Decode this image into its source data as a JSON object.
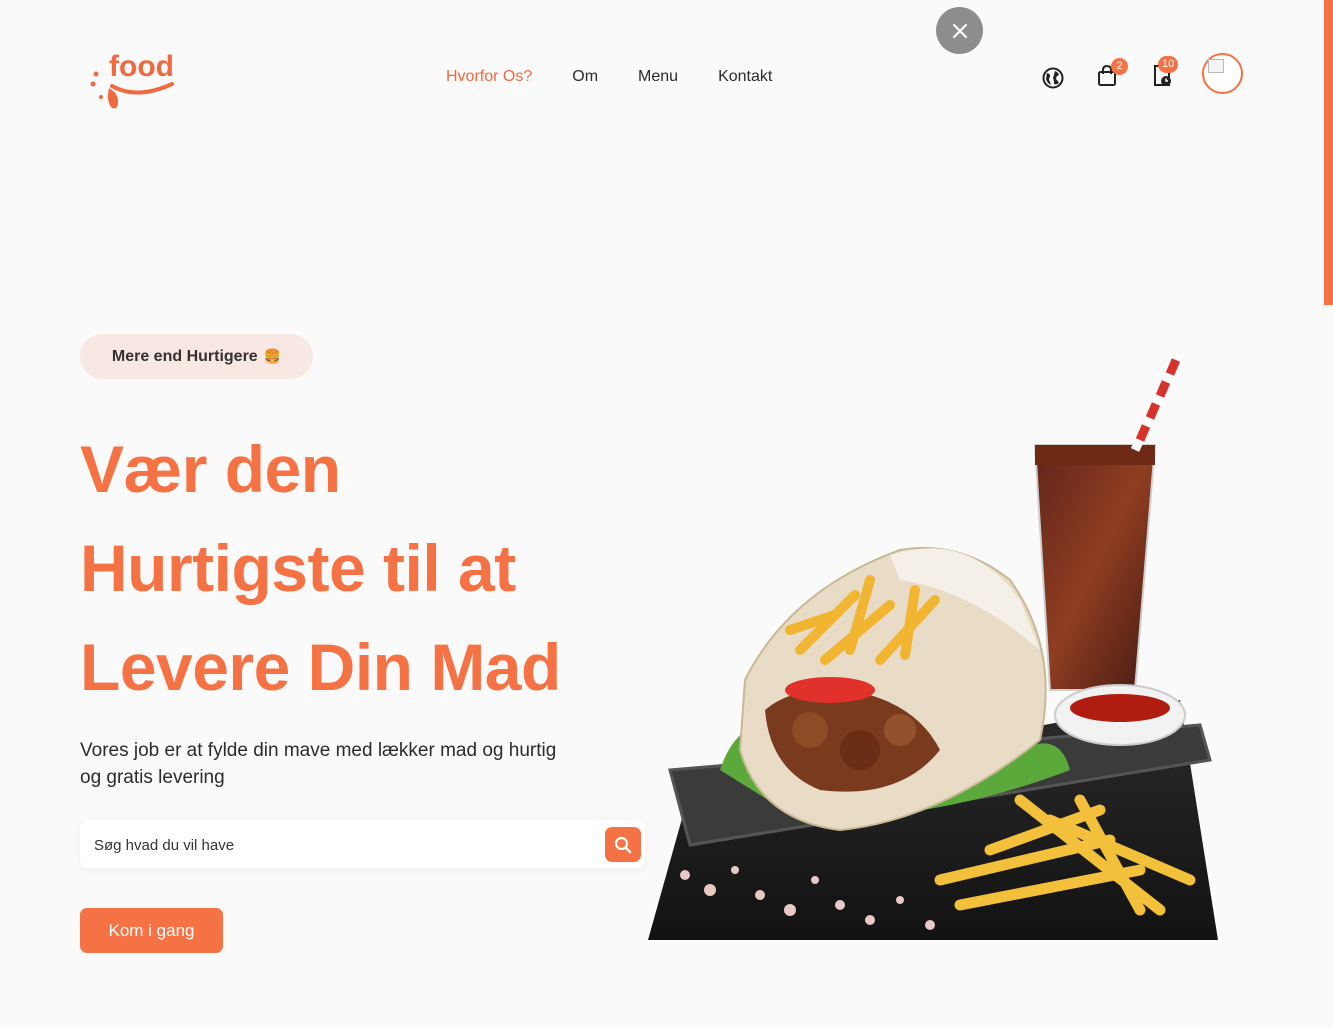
{
  "brand": {
    "logo_text": "food",
    "accent": "#f47244"
  },
  "nav": {
    "items": [
      {
        "label": "Hvorfor Os?",
        "active": true
      },
      {
        "label": "Om",
        "active": false
      },
      {
        "label": "Menu",
        "active": false
      },
      {
        "label": "Kontakt",
        "active": false
      }
    ]
  },
  "header_icons": {
    "language": {
      "icon": "globe-icon"
    },
    "cart": {
      "icon": "shopping-bag-icon",
      "badge": "2"
    },
    "orders": {
      "icon": "order-history-icon",
      "badge": "10"
    },
    "profile": {
      "icon": "avatar"
    },
    "close": {
      "icon": "close-icon"
    }
  },
  "hero": {
    "tagline": "Mere end Hurtigere",
    "tagline_emoji": "🍔",
    "headline": [
      "Vær den",
      "Hurtigste til at",
      "Levere Din Mad"
    ],
    "subtitle": "Vores job er at fylde din mave med lækker mad og hurtig og gratis levering",
    "search_placeholder": "Søg hvad du vil have",
    "cta_label": "Kom i gang"
  }
}
